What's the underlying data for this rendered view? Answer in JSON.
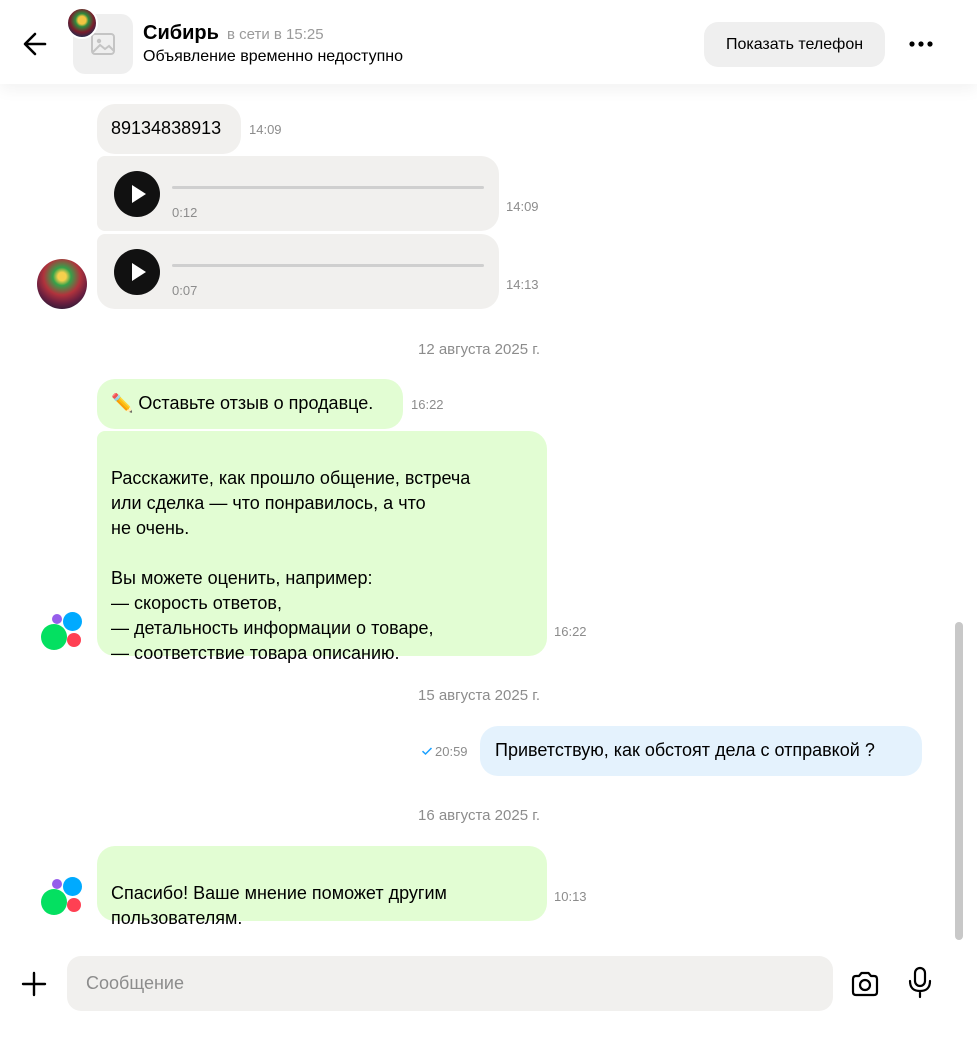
{
  "header": {
    "contact_name": "Сибирь",
    "contact_status": "в сети в 15:25",
    "ad_status": "Объявление временно недоступно",
    "show_phone_label": "Показать телефон",
    "icons": {
      "back": "arrow-left-icon",
      "more": "more-horizontal-icon",
      "ad_placeholder": "image-placeholder-icon"
    }
  },
  "messages": {
    "m1": {
      "text": "89134838913",
      "time": "14:09"
    },
    "v1": {
      "duration": "0:12",
      "time": "14:09"
    },
    "v2": {
      "duration": "0:07",
      "time": "14:13"
    },
    "d1": "12 августа 2025 г.",
    "m2": {
      "text": "✏️ Оставьте отзыв о продавце.",
      "time": "16:22"
    },
    "m3": {
      "text": "Расскажите, как прошло общение, встреча\nили сделка — что понравилось, а что\nне очень.\n\nВы можете оценить, например:\n— скорость ответов,\n— детальность информации о товаре,\n— соответствие товара описанию.",
      "time": "16:22"
    },
    "d2": "15 августа 2025 г.",
    "m4": {
      "text": "Приветствую, как обстоят дела с отправкой ?",
      "time": "20:59",
      "status_icon": "check-icon"
    },
    "d3": "16 августа 2025 г.",
    "m5": {
      "text": "Спасибо! Ваше мнение поможет другим\nпользователям.",
      "time": "10:13"
    }
  },
  "composer": {
    "placeholder": "Сообщение",
    "icons": {
      "attach": "plus-icon",
      "camera": "camera-icon",
      "mic": "microphone-icon"
    }
  },
  "colors": {
    "incoming_gray": "#f1f0ee",
    "system_green": "#e2fdd3",
    "outgoing_blue": "#e4f2fd",
    "avito_green": "#04e061",
    "avito_blue": "#0af",
    "avito_red": "#ff4053",
    "avito_purple": "#965eeb",
    "check_blue": "#1aa0ff"
  }
}
